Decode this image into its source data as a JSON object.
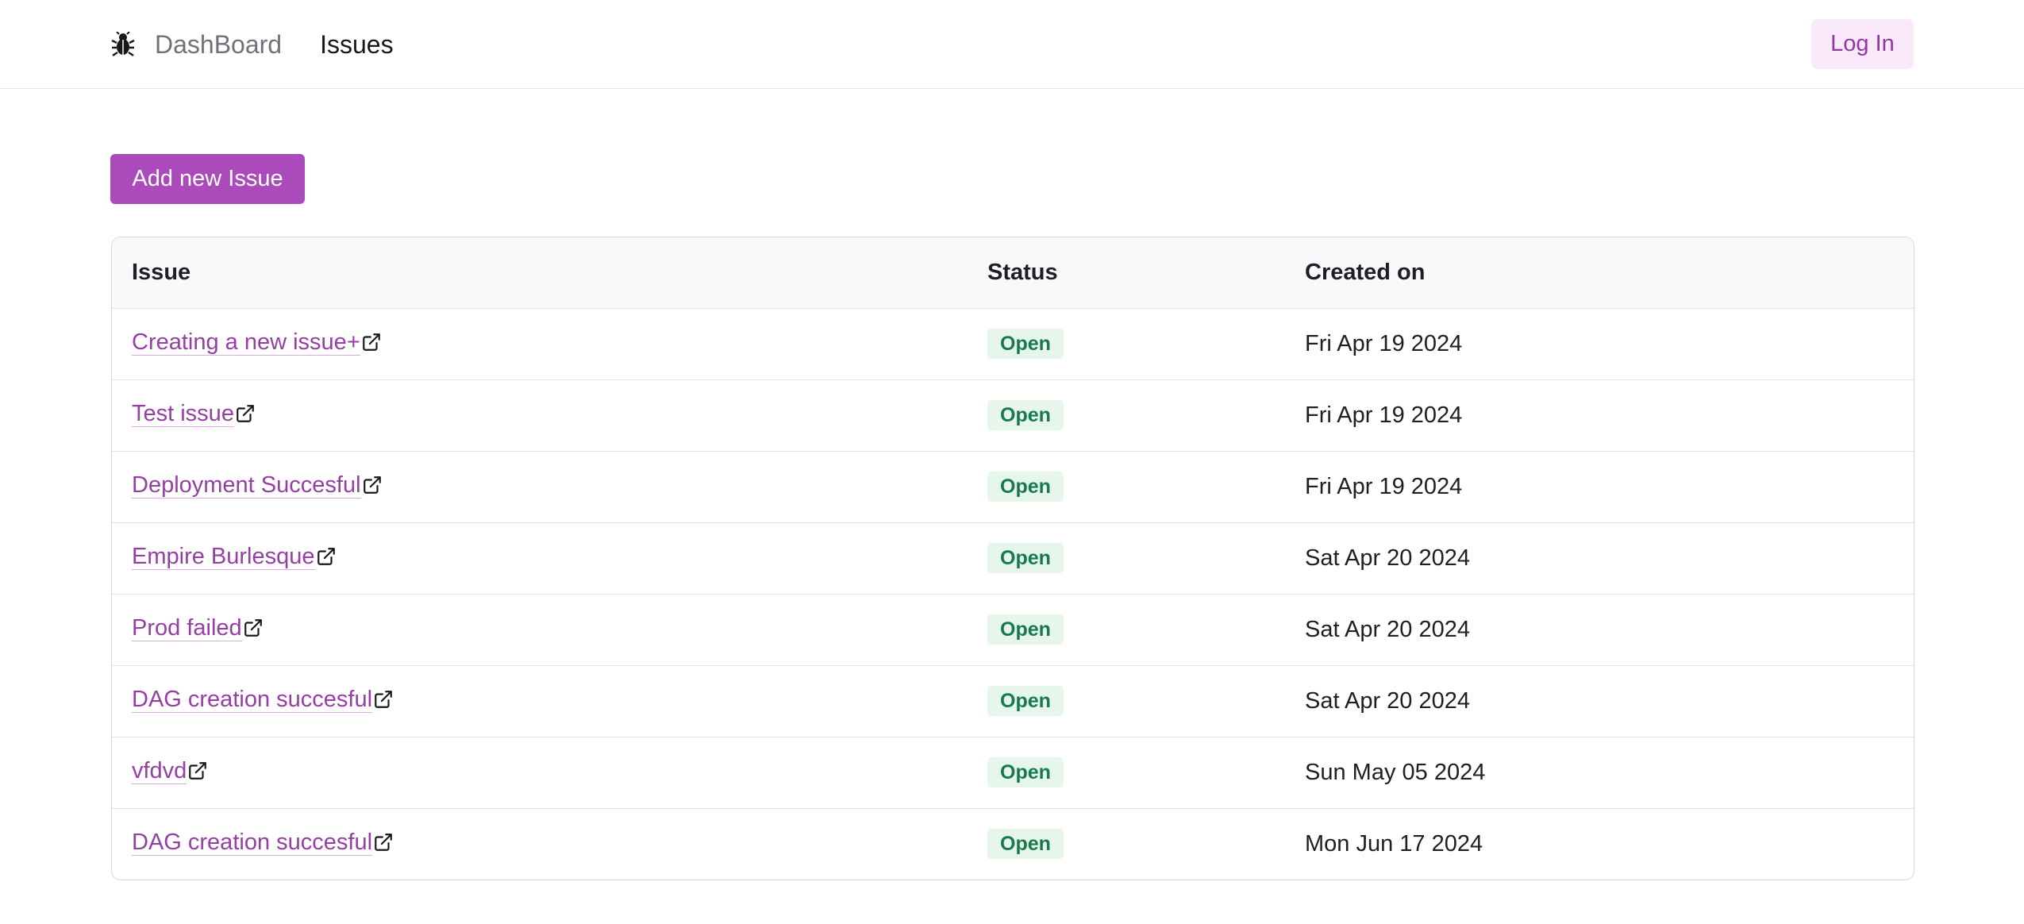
{
  "nav": {
    "logo_icon": "bug-icon",
    "links": [
      {
        "label": "DashBoard",
        "active": false
      },
      {
        "label": "Issues",
        "active": true
      }
    ],
    "login_label": "Log In"
  },
  "toolbar": {
    "add_label": "Add new Issue"
  },
  "table": {
    "headers": {
      "issue": "Issue",
      "status": "Status",
      "created": "Created on"
    },
    "rows": [
      {
        "title": "Creating a new issue+",
        "status": "Open",
        "created": "Fri Apr 19 2024"
      },
      {
        "title": "Test issue",
        "status": "Open",
        "created": "Fri Apr 19 2024"
      },
      {
        "title": "Deployment Succesful",
        "status": "Open",
        "created": "Fri Apr 19 2024"
      },
      {
        "title": "Empire Burlesque",
        "status": "Open",
        "created": "Sat Apr 20 2024"
      },
      {
        "title": "Prod failed",
        "status": "Open",
        "created": "Sat Apr 20 2024"
      },
      {
        "title": "DAG creation succesful",
        "status": "Open",
        "created": "Sat Apr 20 2024"
      },
      {
        "title": "vfdvd",
        "status": "Open",
        "created": "Sun May 05 2024"
      },
      {
        "title": "DAG creation succesful",
        "status": "Open",
        "created": "Mon Jun 17 2024"
      }
    ]
  },
  "colors": {
    "accent": "#ab4aba",
    "link": "#953ea3",
    "status_open_bg": "#e6f6eb",
    "status_open_text": "#18794e"
  }
}
